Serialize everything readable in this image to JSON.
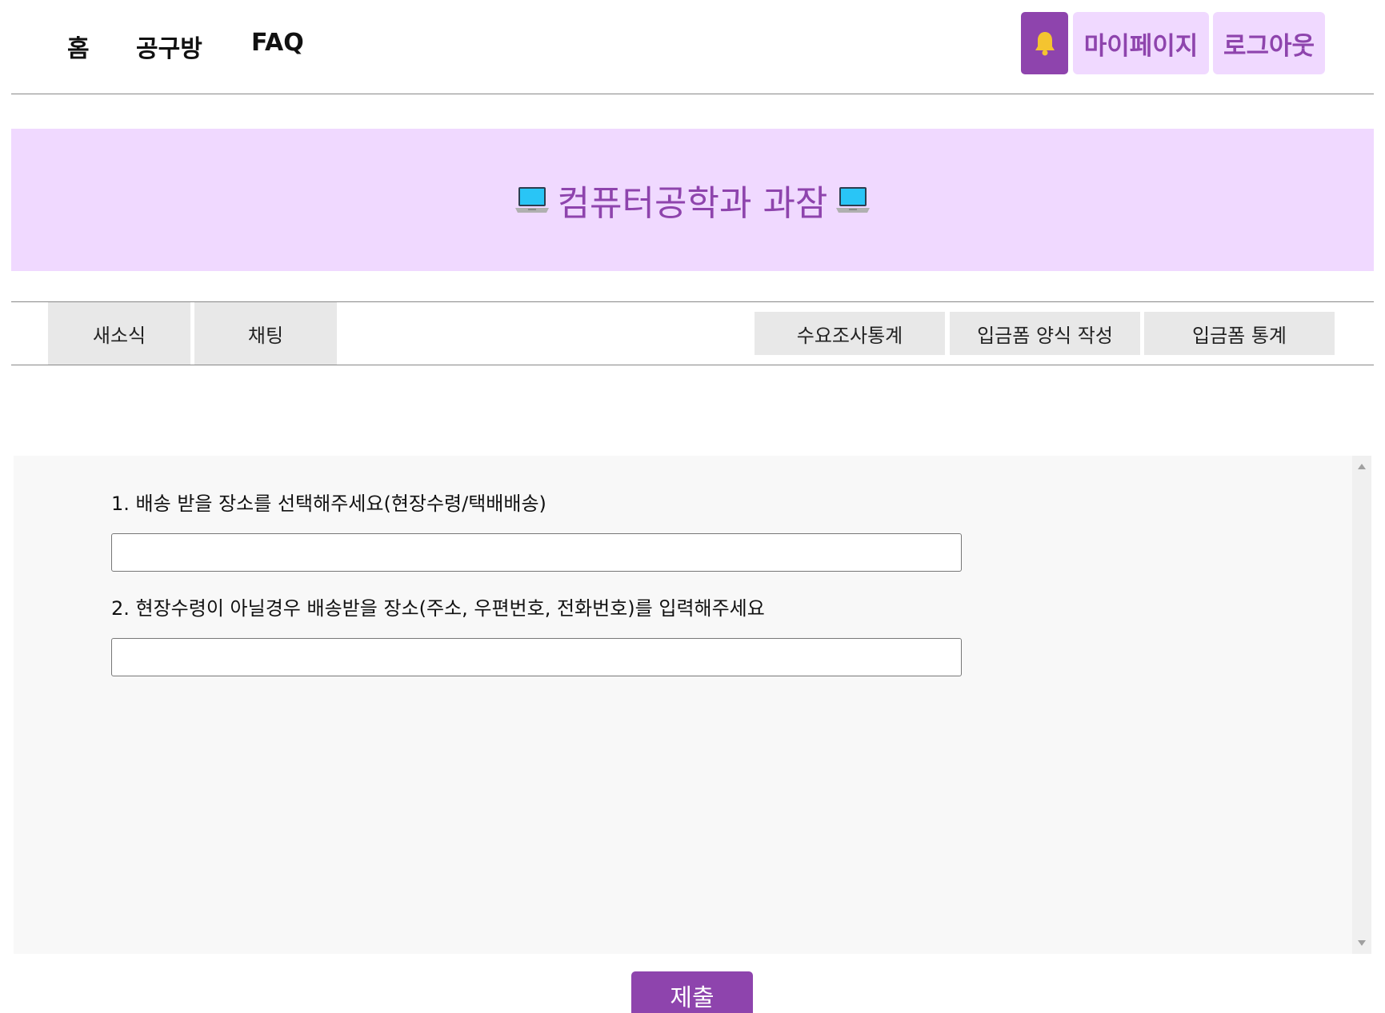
{
  "nav": {
    "home": "홈",
    "group_buy": "공구방",
    "faq": "FAQ",
    "mypage": "마이페이지",
    "logout": "로그아웃"
  },
  "banner": {
    "title": "컴퓨터공학과 과잠",
    "icon": "laptop-icon"
  },
  "tabs": {
    "left": [
      "새소식",
      "채팅"
    ],
    "right": [
      "수요조사통계",
      "입금폼 양식 작성",
      "입금폼 통계"
    ]
  },
  "form": {
    "questions": [
      {
        "label": "1. 배송 받을 장소를 선택해주세요(현장수령/택배배송)",
        "value": ""
      },
      {
        "label": "2. 현장수령이 아닐경우 배송받을 장소(주소, 우편번호, 전화번호)를 입력해주세요",
        "value": ""
      }
    ],
    "submit_label": "제출"
  },
  "colors": {
    "accent": "#8e44ad",
    "accent_light": "#f0d9ff",
    "bell": "#f4c430"
  }
}
